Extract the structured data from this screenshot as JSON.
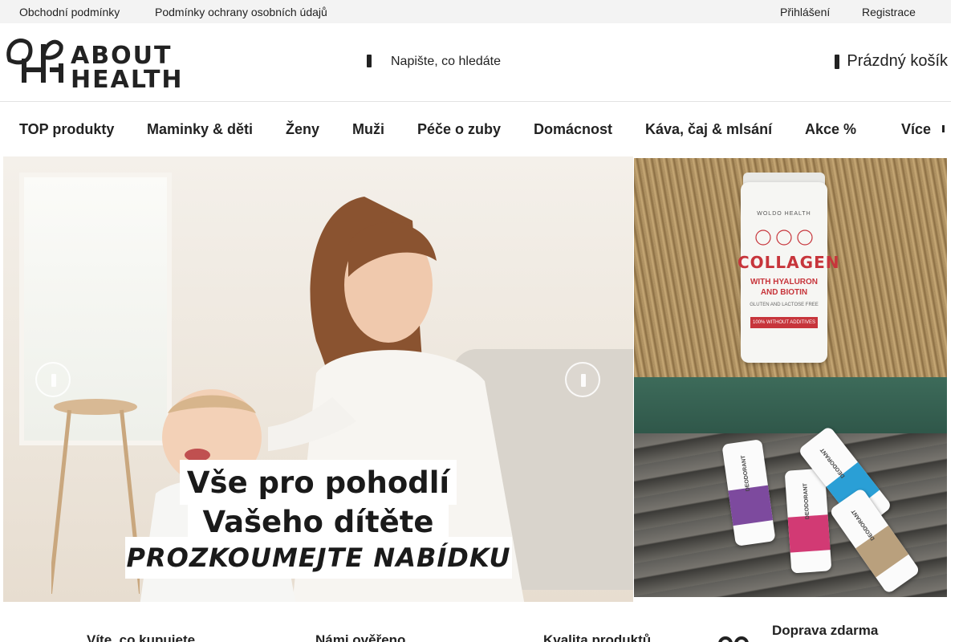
{
  "topbar": {
    "links": [
      "Obchodní podmínky",
      "Podmínky ochrany osobních údajů"
    ],
    "login": "Přihlášení",
    "register": "Registrace"
  },
  "header": {
    "logo_line1": "ABOUT",
    "logo_line2": "HEALTH",
    "search_placeholder": "Napište, co hledáte",
    "cart_label": "Prázdný košík"
  },
  "nav": {
    "items": [
      "TOP produkty",
      "Maminky & děti",
      "Ženy",
      "Muži",
      "Péče o zuby",
      "Domácnost",
      "Káva, čaj & mlsání",
      "Akce %"
    ],
    "more": "Více"
  },
  "hero": {
    "line1": "Vše pro pohodlí",
    "line2": "Vašeho dítěte",
    "line3": "PROZKOUMEJTE NABÍDKU"
  },
  "promo1": {
    "brand": "WOLDO HEALTH",
    "title": "COLLAGEN",
    "subtitle": "WITH HYALURON AND BIOTIN",
    "small": "GLUTEN AND LACTOSE FREE",
    "strip": "100% WITHOUT ADDITIVES"
  },
  "promo2": {
    "label": "DEODORANT"
  },
  "benefits": [
    "Víte, co kupujete",
    "Námi ověřeno",
    "Kvalita produktů",
    "Doprava zdarma"
  ],
  "colors": {
    "topbar_bg": "#f3f3f3",
    "text": "#222222",
    "collagen_red": "#c7353b"
  }
}
